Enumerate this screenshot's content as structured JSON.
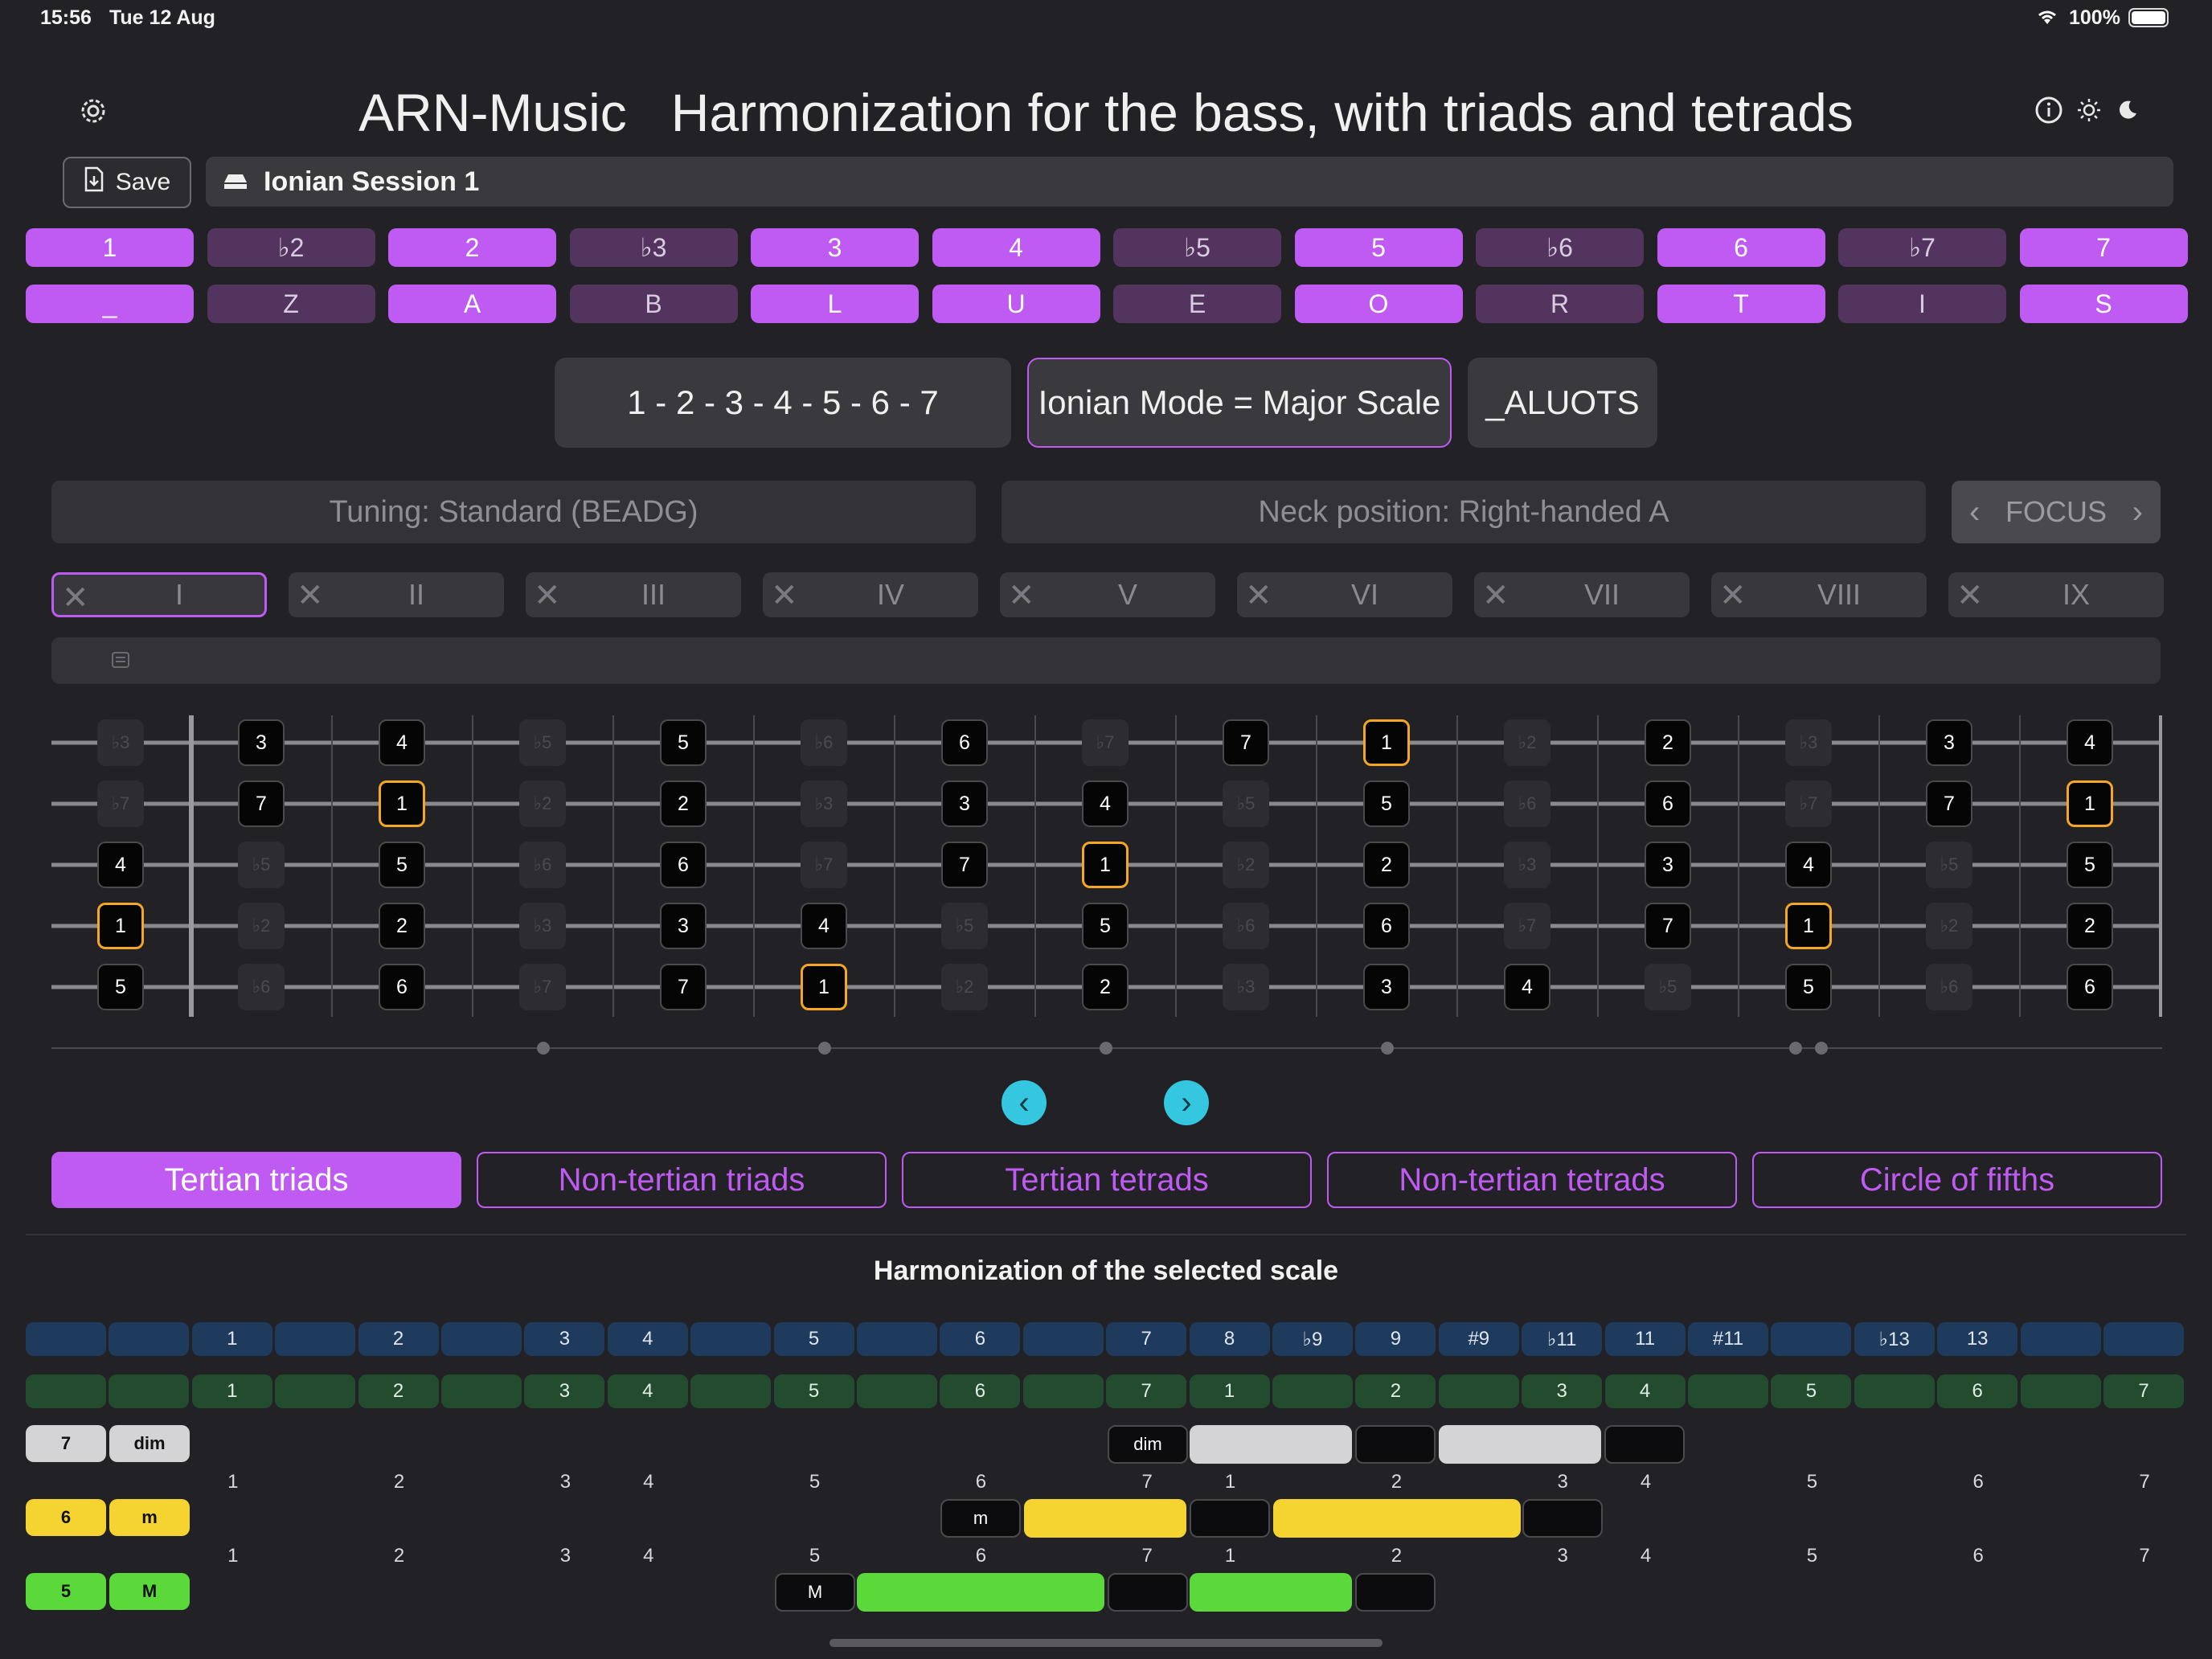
{
  "status": {
    "time": "15:56",
    "date": "Tue 12 Aug",
    "battery": "100%",
    "wifi_icon": "wifi-icon",
    "battery_icon": "battery-icon"
  },
  "header": {
    "title": "ARN-Music   Harmonization for the bass, with triads and tetrads"
  },
  "toolbar": {
    "save_label": "Save",
    "session_name": "Ionian Session 1"
  },
  "degrees": {
    "row1": [
      {
        "t": "1",
        "on": true
      },
      {
        "t": "♭2",
        "on": false
      },
      {
        "t": "2",
        "on": true
      },
      {
        "t": "♭3",
        "on": false
      },
      {
        "t": "3",
        "on": true
      },
      {
        "t": "4",
        "on": true
      },
      {
        "t": "♭5",
        "on": false
      },
      {
        "t": "5",
        "on": true
      },
      {
        "t": "♭6",
        "on": false
      },
      {
        "t": "6",
        "on": true
      },
      {
        "t": "♭7",
        "on": false
      },
      {
        "t": "7",
        "on": true
      }
    ],
    "row2": [
      {
        "t": "_",
        "on": true
      },
      {
        "t": "Z",
        "on": false
      },
      {
        "t": "A",
        "on": true
      },
      {
        "t": "B",
        "on": false
      },
      {
        "t": "L",
        "on": true
      },
      {
        "t": "U",
        "on": true
      },
      {
        "t": "E",
        "on": false
      },
      {
        "t": "O",
        "on": true
      },
      {
        "t": "R",
        "on": false
      },
      {
        "t": "T",
        "on": true
      },
      {
        "t": "I",
        "on": false
      },
      {
        "t": "S",
        "on": true
      }
    ]
  },
  "scale": {
    "formula": "1 - 2 - 3 - 4 - 5 - 6 - 7",
    "name": "Ionian Mode = Major Scale",
    "code": "_ALUOTS"
  },
  "settings": {
    "tuning": "Tuning: Standard (BEADG)",
    "neck": "Neck position: Right-handed A",
    "focus": "FOCUS"
  },
  "positions": [
    "I",
    "II",
    "III",
    "IV",
    "V",
    "VI",
    "VII",
    "VIII",
    "IX"
  ],
  "fretboard": {
    "strings": [
      [
        "♭3",
        "3",
        "4",
        "♭5",
        "5",
        "♭6",
        "6",
        "♭7",
        "7",
        "1",
        "♭2",
        "2",
        "♭3",
        "3",
        "4"
      ],
      [
        "♭7",
        "7",
        "1",
        "♭2",
        "2",
        "♭3",
        "3",
        "4",
        "♭5",
        "5",
        "♭6",
        "6",
        "♭7",
        "7",
        "1"
      ],
      [
        "4",
        "♭5",
        "5",
        "♭6",
        "6",
        "♭7",
        "7",
        "1",
        "♭2",
        "2",
        "♭3",
        "3",
        "4",
        "♭5",
        "5"
      ],
      [
        "1",
        "♭2",
        "2",
        "♭3",
        "3",
        "4",
        "♭5",
        "5",
        "♭6",
        "6",
        "♭7",
        "7",
        "1",
        "♭2",
        "2"
      ],
      [
        "5",
        "♭6",
        "6",
        "♭7",
        "7",
        "1",
        "♭2",
        "2",
        "♭3",
        "3",
        "4",
        "♭5",
        "5",
        "♭6",
        "6"
      ]
    ]
  },
  "tabs": [
    "Tertian triads",
    "Non-tertian triads",
    "Tertian tetrads",
    "Non-tertian tetrads",
    "Circle of fifths"
  ],
  "harmonization": {
    "title": "Harmonization of the selected scale",
    "intervals": [
      "",
      "",
      "1",
      "",
      "2",
      "",
      "3",
      "4",
      "",
      "5",
      "",
      "6",
      "",
      "7",
      "8",
      "♭9",
      "9",
      "#9",
      "♭11",
      "11",
      "#11",
      "",
      "♭13",
      "13",
      "",
      "",
      ""
    ],
    "degrees": [
      "",
      "",
      "1",
      "",
      "2",
      "",
      "3",
      "4",
      "",
      "5",
      "",
      "6",
      "",
      "7",
      "1",
      "",
      "2",
      "",
      "3",
      "4",
      "",
      "5",
      "",
      "6",
      "",
      "7"
    ],
    "num_row": [
      "",
      "",
      "1",
      "",
      "2",
      "",
      "3",
      "4",
      "",
      "5",
      "",
      "6",
      "",
      "7",
      "1",
      "",
      "2",
      "",
      "3",
      "4",
      "",
      "5",
      "",
      "6",
      "",
      "7"
    ],
    "chords": [
      {
        "degree": "7",
        "quality": "dim",
        "tag": "dim"
      },
      {
        "degree": "6",
        "quality": "m",
        "tag": "m"
      },
      {
        "degree": "5",
        "quality": "M",
        "tag": "M"
      }
    ]
  }
}
